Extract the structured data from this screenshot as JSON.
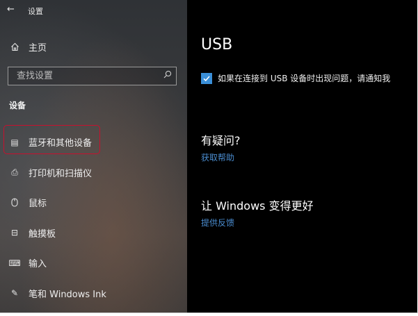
{
  "window": {
    "back_glyph": "←",
    "title": "设置"
  },
  "sidebar": {
    "home_label": "主页",
    "search_placeholder": "查找设置",
    "section_title": "设备",
    "items": [
      {
        "label": "蓝牙和其他设备",
        "icon": "bluetooth-devices-icon",
        "glyph": "▤"
      },
      {
        "label": "打印机和扫描仪",
        "icon": "printer-icon",
        "glyph": "⎙"
      },
      {
        "label": "鼠标",
        "icon": "mouse-icon",
        "glyph": "⌒"
      },
      {
        "label": "触摸板",
        "icon": "touchpad-icon",
        "glyph": "⊟"
      },
      {
        "label": "输入",
        "icon": "keyboard-icon",
        "glyph": "⌨"
      },
      {
        "label": "笔和 Windows Ink",
        "icon": "pen-icon",
        "glyph": "✎"
      }
    ]
  },
  "main": {
    "heading": "USB",
    "checkbox": {
      "checked": true,
      "label": "如果在连接到 USB 设备时出现问题，请通知我"
    },
    "help": {
      "heading": "有疑问?",
      "link": "获取帮助"
    },
    "feedback": {
      "heading": "让 Windows 变得更好",
      "link": "提供反馈"
    }
  },
  "colors": {
    "accent": "#3a8fd8",
    "link": "#4a8ccf",
    "highlight": "#c8102e",
    "content_bg": "#000000"
  }
}
